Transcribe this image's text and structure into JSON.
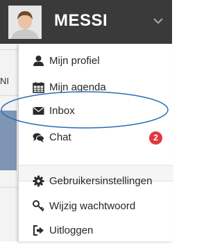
{
  "header": {
    "username": "MESSI",
    "avatar_icon": "user-avatar",
    "toggle_icon": "chevron-down-icon"
  },
  "background": {
    "partial_text": "NI"
  },
  "menu": {
    "items": [
      {
        "label": "Mijn profiel",
        "icon": "user-icon"
      },
      {
        "label": "Mijn agenda",
        "icon": "calendar-icon"
      },
      {
        "label": "Inbox",
        "icon": "envelope-icon"
      },
      {
        "label": "Chat",
        "icon": "chat-icon",
        "badge": "2"
      }
    ],
    "settings_items": [
      {
        "label": "Gebruikersinstellingen",
        "icon": "gear-icon"
      },
      {
        "label": "Wijzig wachtwoord",
        "icon": "key-icon"
      },
      {
        "label": "Uitloggen",
        "icon": "sign-out-icon"
      }
    ]
  },
  "colors": {
    "topbar": "#3a3a3a",
    "badge": "#e0383f",
    "highlight_ellipse": "#2b6cb5"
  }
}
